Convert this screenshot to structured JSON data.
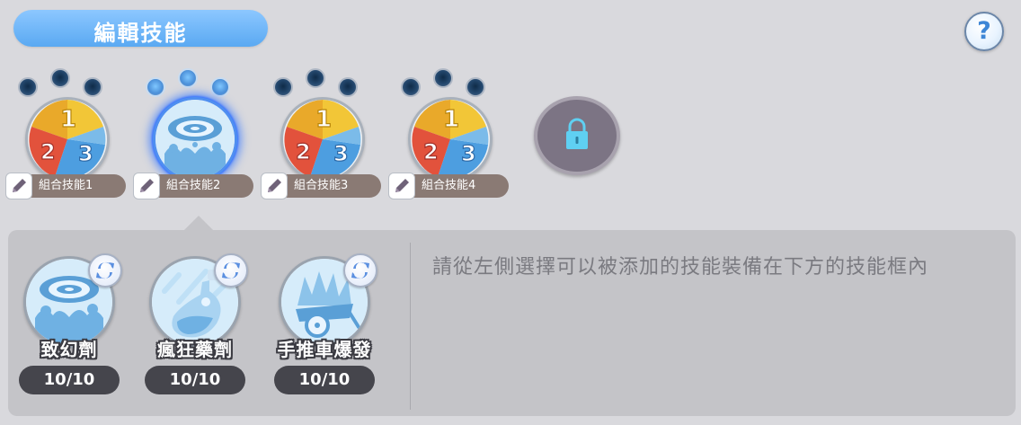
{
  "header": {
    "title": "編輯技能",
    "help_label": "?"
  },
  "combo_slots": [
    {
      "label": "組合技能1",
      "icon": "combo-123-icon",
      "selected": false
    },
    {
      "label": "組合技能2",
      "icon": "swirl-splash-icon",
      "selected": true
    },
    {
      "label": "組合技能3",
      "icon": "combo-123-icon",
      "selected": false
    },
    {
      "label": "組合技能4",
      "icon": "combo-123-icon",
      "selected": false
    }
  ],
  "locked_slot": {
    "icon": "lock-icon"
  },
  "skill_panel": {
    "instruction": "請從左側選擇可以被添加的技能裝備在下方的技能框內",
    "items": [
      {
        "name": "致幻劑",
        "count": "10/10",
        "icon": "swirl-splash-icon"
      },
      {
        "name": "瘋狂藥劑",
        "count": "10/10",
        "icon": "potion-flask-icon"
      },
      {
        "name": "手推車爆發",
        "count": "10/10",
        "icon": "cart-burst-icon"
      }
    ]
  },
  "colors": {
    "background": "#d9d9dd",
    "title_pill": "#5aa9f2",
    "panel": "#c4c4c8",
    "name_tag": "#8a7a74",
    "selection_glow": "#3778ff"
  }
}
